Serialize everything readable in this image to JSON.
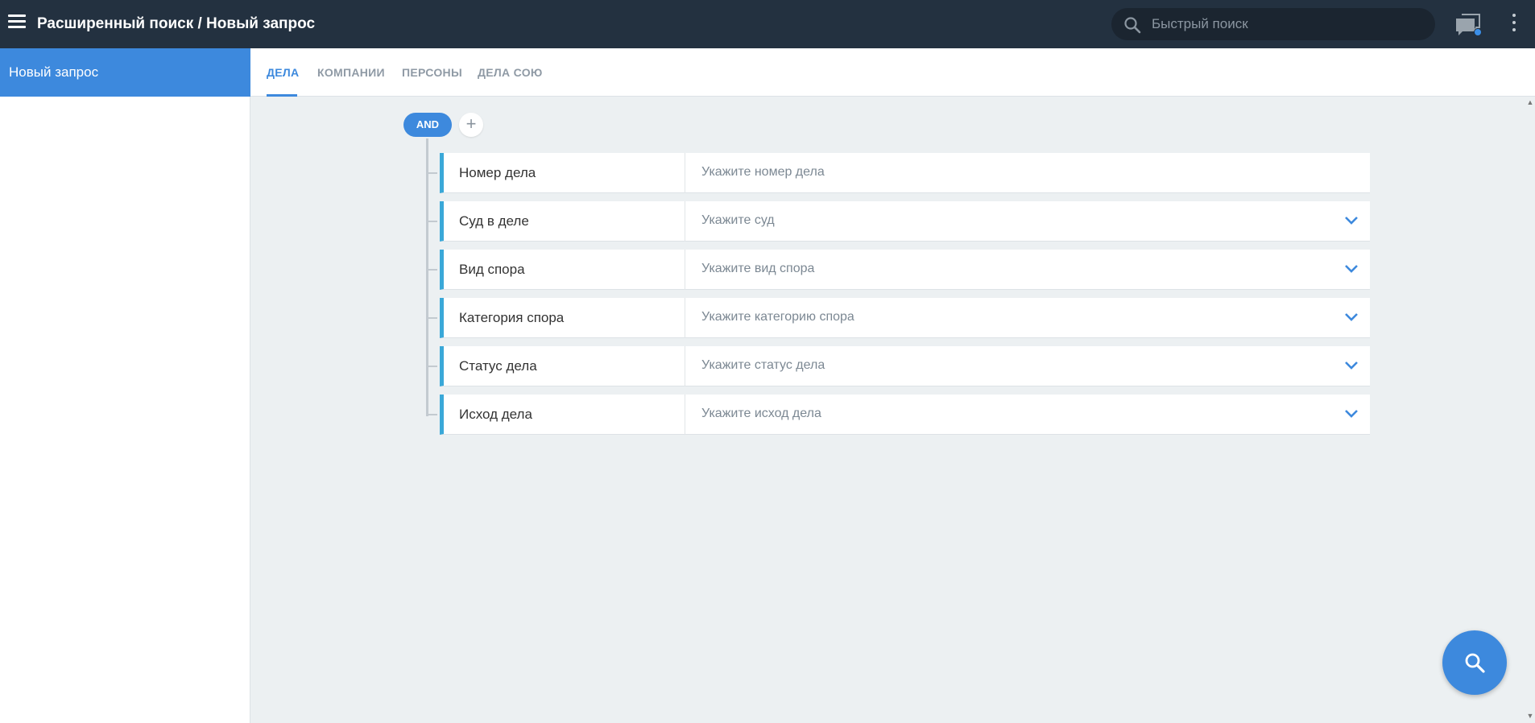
{
  "header": {
    "title": "Расширенный поиск / Новый запрос",
    "search_placeholder": "Быстрый поиск"
  },
  "sidebar": {
    "items": [
      {
        "label": "Новый запрос",
        "active": true
      }
    ]
  },
  "tabs": [
    {
      "label": "ДЕЛА",
      "active": true
    },
    {
      "label": "КОМПАНИИ",
      "active": false
    },
    {
      "label": "ПЕРСОНЫ",
      "active": false
    },
    {
      "label": "ДЕЛА СОЮ",
      "active": false
    }
  ],
  "query": {
    "operator_label": "AND",
    "add_label": "+",
    "filters": [
      {
        "label": "Номер дела",
        "placeholder": "Укажите номер дела",
        "dropdown": false
      },
      {
        "label": "Суд в деле",
        "placeholder": "Укажите суд",
        "dropdown": true
      },
      {
        "label": "Вид спора",
        "placeholder": "Укажите вид спора",
        "dropdown": true
      },
      {
        "label": "Категория спора",
        "placeholder": "Укажите категорию спора",
        "dropdown": true
      },
      {
        "label": "Статус дела",
        "placeholder": "Укажите статус дела",
        "dropdown": true
      },
      {
        "label": "Исход дела",
        "placeholder": "Укажите исход дела",
        "dropdown": true
      }
    ]
  },
  "colors": {
    "topbar": "#233140",
    "accent": "#3d89dd",
    "row_accent": "#3aa8d8",
    "content_bg": "#ecf0f2"
  },
  "icons": {
    "menu": "hamburger-menu-icon",
    "search": "search-icon",
    "chat": "chat-icon",
    "more": "kebab-menu-icon",
    "chevron": "chevron-down-icon"
  }
}
